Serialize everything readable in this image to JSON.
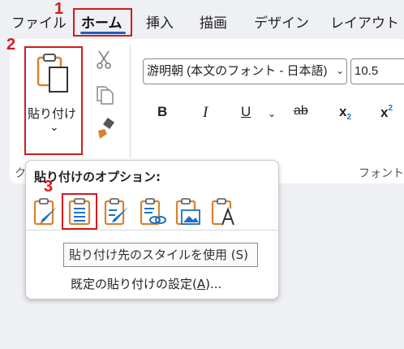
{
  "tabs": [
    {
      "label": "ファイル",
      "active": false
    },
    {
      "label": "ホーム",
      "active": true
    },
    {
      "label": "挿入",
      "active": false
    },
    {
      "label": "描画",
      "active": false
    },
    {
      "label": "デザイン",
      "active": false
    },
    {
      "label": "レイアウト",
      "active": false
    }
  ],
  "steps": [
    "1",
    "2",
    "3"
  ],
  "clipboard": {
    "paste_label": "貼り付け",
    "paste_arrow": "⌄",
    "group_label_partial": "ク",
    "cut_icon": "scissors-icon",
    "copy_icon": "copy-icon",
    "format_painter_icon": "format-painter-icon"
  },
  "font": {
    "font_name": "游明朝 (本文のフォント - 日本語)",
    "font_size": "10.5",
    "bold": "B",
    "italic": "I",
    "underline": "U",
    "strike": "ab",
    "subscript": "x",
    "subscript_mark": "2",
    "superscript": "x",
    "superscript_mark": "2",
    "group_label": "フォント"
  },
  "paste_menu": {
    "title": "貼り付けのオプション:",
    "options": [
      {
        "icon": "keep-source-formatting-icon"
      },
      {
        "icon": "use-destination-styles-icon"
      },
      {
        "icon": "merge-formatting-icon"
      },
      {
        "icon": "link-keep-source-icon"
      },
      {
        "icon": "paste-as-picture-icon"
      },
      {
        "icon": "keep-text-only-icon"
      }
    ],
    "tooltip": "貼り付け先のスタイルを使用 (S)",
    "default_setting_prefix": "既定の貼り付けの設定(",
    "default_setting_key": "A",
    "default_setting_suffix": ")..."
  },
  "colors": {
    "accent_red": "#d51a1a",
    "clipboard_orange": "#d9822b",
    "icon_blue": "#1f6fc5"
  }
}
